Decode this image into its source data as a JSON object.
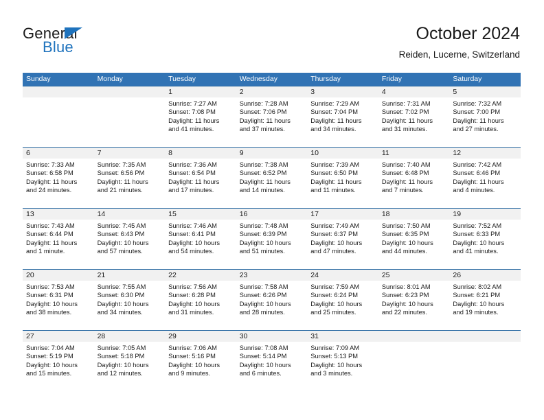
{
  "logo": {
    "word1": "General",
    "word2": "Blue",
    "triangle_icon": "triangle-icon",
    "brand_blue": "#1f73bd"
  },
  "header": {
    "title": "October 2024",
    "subtitle": "Reiden, Lucerne, Switzerland"
  },
  "theme": {
    "header_blue": "#3173b4",
    "row_divider_blue": "#2e6da4",
    "date_band_gray": "#f1f1f1",
    "cell_white": "#ffffff",
    "text_dark": "#1a1a1a"
  },
  "calendar": {
    "day_headers": [
      "Sunday",
      "Monday",
      "Tuesday",
      "Wednesday",
      "Thursday",
      "Friday",
      "Saturday"
    ],
    "weeks": [
      {
        "dates": [
          "",
          "",
          "1",
          "2",
          "3",
          "4",
          "5"
        ],
        "cells": [
          {
            "day": "",
            "sunrise": "",
            "sunset": "",
            "daylight_line1": "",
            "daylight_line2": ""
          },
          {
            "day": "",
            "sunrise": "",
            "sunset": "",
            "daylight_line1": "",
            "daylight_line2": ""
          },
          {
            "day": "1",
            "sunrise": "Sunrise: 7:27 AM",
            "sunset": "Sunset: 7:08 PM",
            "daylight_line1": "Daylight: 11 hours",
            "daylight_line2": "and 41 minutes."
          },
          {
            "day": "2",
            "sunrise": "Sunrise: 7:28 AM",
            "sunset": "Sunset: 7:06 PM",
            "daylight_line1": "Daylight: 11 hours",
            "daylight_line2": "and 37 minutes."
          },
          {
            "day": "3",
            "sunrise": "Sunrise: 7:29 AM",
            "sunset": "Sunset: 7:04 PM",
            "daylight_line1": "Daylight: 11 hours",
            "daylight_line2": "and 34 minutes."
          },
          {
            "day": "4",
            "sunrise": "Sunrise: 7:31 AM",
            "sunset": "Sunset: 7:02 PM",
            "daylight_line1": "Daylight: 11 hours",
            "daylight_line2": "and 31 minutes."
          },
          {
            "day": "5",
            "sunrise": "Sunrise: 7:32 AM",
            "sunset": "Sunset: 7:00 PM",
            "daylight_line1": "Daylight: 11 hours",
            "daylight_line2": "and 27 minutes."
          }
        ]
      },
      {
        "dates": [
          "6",
          "7",
          "8",
          "9",
          "10",
          "11",
          "12"
        ],
        "cells": [
          {
            "day": "6",
            "sunrise": "Sunrise: 7:33 AM",
            "sunset": "Sunset: 6:58 PM",
            "daylight_line1": "Daylight: 11 hours",
            "daylight_line2": "and 24 minutes."
          },
          {
            "day": "7",
            "sunrise": "Sunrise: 7:35 AM",
            "sunset": "Sunset: 6:56 PM",
            "daylight_line1": "Daylight: 11 hours",
            "daylight_line2": "and 21 minutes."
          },
          {
            "day": "8",
            "sunrise": "Sunrise: 7:36 AM",
            "sunset": "Sunset: 6:54 PM",
            "daylight_line1": "Daylight: 11 hours",
            "daylight_line2": "and 17 minutes."
          },
          {
            "day": "9",
            "sunrise": "Sunrise: 7:38 AM",
            "sunset": "Sunset: 6:52 PM",
            "daylight_line1": "Daylight: 11 hours",
            "daylight_line2": "and 14 minutes."
          },
          {
            "day": "10",
            "sunrise": "Sunrise: 7:39 AM",
            "sunset": "Sunset: 6:50 PM",
            "daylight_line1": "Daylight: 11 hours",
            "daylight_line2": "and 11 minutes."
          },
          {
            "day": "11",
            "sunrise": "Sunrise: 7:40 AM",
            "sunset": "Sunset: 6:48 PM",
            "daylight_line1": "Daylight: 11 hours",
            "daylight_line2": "and 7 minutes."
          },
          {
            "day": "12",
            "sunrise": "Sunrise: 7:42 AM",
            "sunset": "Sunset: 6:46 PM",
            "daylight_line1": "Daylight: 11 hours",
            "daylight_line2": "and 4 minutes."
          }
        ]
      },
      {
        "dates": [
          "13",
          "14",
          "15",
          "16",
          "17",
          "18",
          "19"
        ],
        "cells": [
          {
            "day": "13",
            "sunrise": "Sunrise: 7:43 AM",
            "sunset": "Sunset: 6:44 PM",
            "daylight_line1": "Daylight: 11 hours",
            "daylight_line2": "and 1 minute."
          },
          {
            "day": "14",
            "sunrise": "Sunrise: 7:45 AM",
            "sunset": "Sunset: 6:43 PM",
            "daylight_line1": "Daylight: 10 hours",
            "daylight_line2": "and 57 minutes."
          },
          {
            "day": "15",
            "sunrise": "Sunrise: 7:46 AM",
            "sunset": "Sunset: 6:41 PM",
            "daylight_line1": "Daylight: 10 hours",
            "daylight_line2": "and 54 minutes."
          },
          {
            "day": "16",
            "sunrise": "Sunrise: 7:48 AM",
            "sunset": "Sunset: 6:39 PM",
            "daylight_line1": "Daylight: 10 hours",
            "daylight_line2": "and 51 minutes."
          },
          {
            "day": "17",
            "sunrise": "Sunrise: 7:49 AM",
            "sunset": "Sunset: 6:37 PM",
            "daylight_line1": "Daylight: 10 hours",
            "daylight_line2": "and 47 minutes."
          },
          {
            "day": "18",
            "sunrise": "Sunrise: 7:50 AM",
            "sunset": "Sunset: 6:35 PM",
            "daylight_line1": "Daylight: 10 hours",
            "daylight_line2": "and 44 minutes."
          },
          {
            "day": "19",
            "sunrise": "Sunrise: 7:52 AM",
            "sunset": "Sunset: 6:33 PM",
            "daylight_line1": "Daylight: 10 hours",
            "daylight_line2": "and 41 minutes."
          }
        ]
      },
      {
        "dates": [
          "20",
          "21",
          "22",
          "23",
          "24",
          "25",
          "26"
        ],
        "cells": [
          {
            "day": "20",
            "sunrise": "Sunrise: 7:53 AM",
            "sunset": "Sunset: 6:31 PM",
            "daylight_line1": "Daylight: 10 hours",
            "daylight_line2": "and 38 minutes."
          },
          {
            "day": "21",
            "sunrise": "Sunrise: 7:55 AM",
            "sunset": "Sunset: 6:30 PM",
            "daylight_line1": "Daylight: 10 hours",
            "daylight_line2": "and 34 minutes."
          },
          {
            "day": "22",
            "sunrise": "Sunrise: 7:56 AM",
            "sunset": "Sunset: 6:28 PM",
            "daylight_line1": "Daylight: 10 hours",
            "daylight_line2": "and 31 minutes."
          },
          {
            "day": "23",
            "sunrise": "Sunrise: 7:58 AM",
            "sunset": "Sunset: 6:26 PM",
            "daylight_line1": "Daylight: 10 hours",
            "daylight_line2": "and 28 minutes."
          },
          {
            "day": "24",
            "sunrise": "Sunrise: 7:59 AM",
            "sunset": "Sunset: 6:24 PM",
            "daylight_line1": "Daylight: 10 hours",
            "daylight_line2": "and 25 minutes."
          },
          {
            "day": "25",
            "sunrise": "Sunrise: 8:01 AM",
            "sunset": "Sunset: 6:23 PM",
            "daylight_line1": "Daylight: 10 hours",
            "daylight_line2": "and 22 minutes."
          },
          {
            "day": "26",
            "sunrise": "Sunrise: 8:02 AM",
            "sunset": "Sunset: 6:21 PM",
            "daylight_line1": "Daylight: 10 hours",
            "daylight_line2": "and 19 minutes."
          }
        ]
      },
      {
        "dates": [
          "27",
          "28",
          "29",
          "30",
          "31",
          "",
          ""
        ],
        "cells": [
          {
            "day": "27",
            "sunrise": "Sunrise: 7:04 AM",
            "sunset": "Sunset: 5:19 PM",
            "daylight_line1": "Daylight: 10 hours",
            "daylight_line2": "and 15 minutes."
          },
          {
            "day": "28",
            "sunrise": "Sunrise: 7:05 AM",
            "sunset": "Sunset: 5:18 PM",
            "daylight_line1": "Daylight: 10 hours",
            "daylight_line2": "and 12 minutes."
          },
          {
            "day": "29",
            "sunrise": "Sunrise: 7:06 AM",
            "sunset": "Sunset: 5:16 PM",
            "daylight_line1": "Daylight: 10 hours",
            "daylight_line2": "and 9 minutes."
          },
          {
            "day": "30",
            "sunrise": "Sunrise: 7:08 AM",
            "sunset": "Sunset: 5:14 PM",
            "daylight_line1": "Daylight: 10 hours",
            "daylight_line2": "and 6 minutes."
          },
          {
            "day": "31",
            "sunrise": "Sunrise: 7:09 AM",
            "sunset": "Sunset: 5:13 PM",
            "daylight_line1": "Daylight: 10 hours",
            "daylight_line2": "and 3 minutes."
          },
          {
            "day": "",
            "sunrise": "",
            "sunset": "",
            "daylight_line1": "",
            "daylight_line2": ""
          },
          {
            "day": "",
            "sunrise": "",
            "sunset": "",
            "daylight_line1": "",
            "daylight_line2": ""
          }
        ]
      }
    ]
  }
}
